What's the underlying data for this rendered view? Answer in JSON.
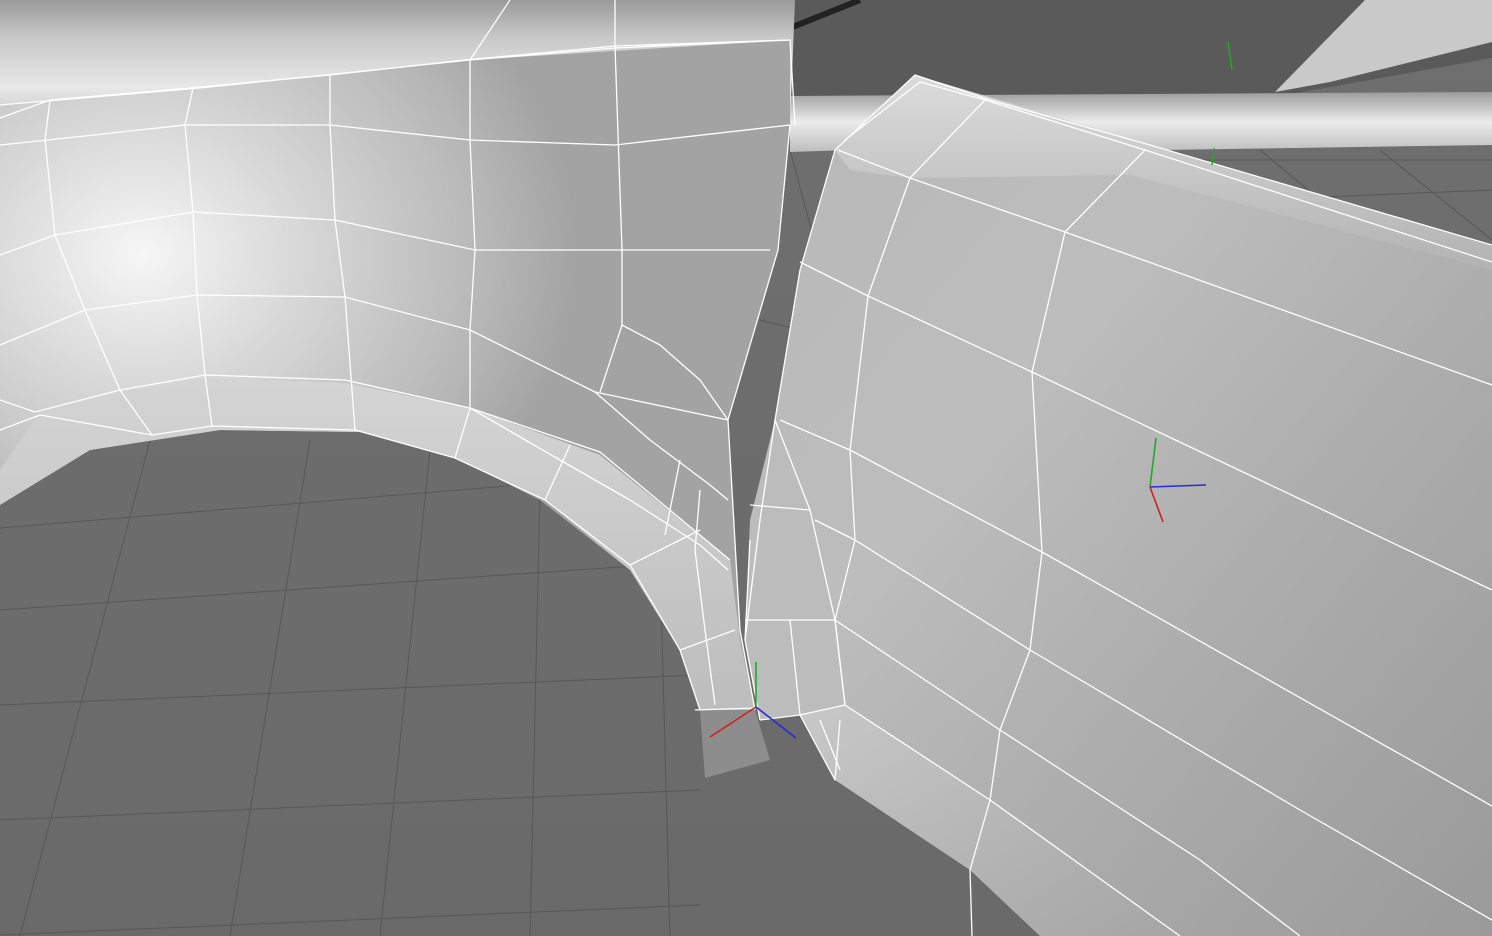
{
  "viewport": {
    "kind": "3d-viewport",
    "shading": "smooth-shaded-with-wireframe",
    "background_color": "#6b6b6b",
    "floor_grid_line_color": "#555555",
    "mesh_base_color": "#a8a8a8",
    "mesh_highlight_color": "#f4f4f4",
    "wireframe_color": "#ffffff",
    "visible_objects": [
      "quarter-panel-mesh",
      "rear-door-mesh",
      "upper-body-panel"
    ],
    "gizmos": [
      {
        "name": "pivot-gizmo-door",
        "axes": [
          "x",
          "y",
          "z"
        ]
      },
      {
        "name": "pivot-gizmo-arch-corner",
        "axes": [
          "x",
          "y",
          "z"
        ]
      },
      {
        "name": "pivot-gizmo-background",
        "axes": [
          "y"
        ]
      }
    ],
    "axis_colors": {
      "x": "#d02020",
      "y": "#22aa22",
      "z": "#2a2ad8"
    }
  }
}
